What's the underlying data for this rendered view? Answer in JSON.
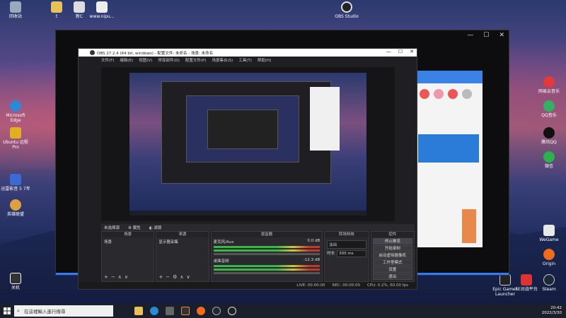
{
  "desktop": {
    "icons_left_top": [
      {
        "label": "回收站",
        "icon": "recycle-bin-icon",
        "color": "#9ab"
      },
      {
        "label": "t",
        "icon": "folder-icon",
        "color": "#e8c15a"
      },
      {
        "label": "新C",
        "icon": "file-icon",
        "color": "#ddd"
      },
      {
        "label": "www.nipu...",
        "icon": "file-icon",
        "color": "#eee"
      }
    ],
    "icons_left": [
      {
        "label": "Microsoft Edge",
        "icon": "edge-icon",
        "color": "#2a8ad4"
      },
      {
        "label": "Ubuntu 远程 Pro",
        "icon": "wifi-icon",
        "color": "#e0b020"
      },
      {
        "label": "迅雷影音 5 7年",
        "icon": "app-icon",
        "color": "#3a6ad4"
      },
      {
        "label": "英雄联盟",
        "icon": "game-icon",
        "color": "#e0a040"
      }
    ],
    "icons_right": [
      {
        "label": "网易云音乐",
        "icon": "music-icon",
        "color": "#e23a3a"
      },
      {
        "label": "QQ音乐",
        "icon": "qqmusic-icon",
        "color": "#30b060"
      },
      {
        "label": "腾讯QQ",
        "icon": "qq-icon",
        "color": "#111"
      },
      {
        "label": "微信",
        "icon": "wechat-icon",
        "color": "#2bb24c"
      },
      {
        "label": "WeGame",
        "icon": "wegame-icon",
        "color": "#e8e8e8"
      },
      {
        "label": "Origin",
        "icon": "origin-icon",
        "color": "#f26a1b"
      },
      {
        "label": "Epic Games Launcher",
        "icon": "epic-icon",
        "color": "#222"
      },
      {
        "label": "5E对战平台",
        "icon": "5e-icon",
        "color": "#d33"
      },
      {
        "label": "Steam",
        "icon": "steam-icon",
        "color": "#1b2838"
      }
    ],
    "top_center_icon": {
      "label": "OBS Studio",
      "icon": "obs-icon"
    },
    "bottom_left_icon": {
      "label": "关机",
      "icon": "power-icon"
    }
  },
  "obs": {
    "title": "OBS 27.2.4 (64 bit, windows) - 配置文件: 未命名 - 场景: 未命名",
    "menu": [
      "文件(F)",
      "编辑(E)",
      "视图(V)",
      "停靠部件(D)",
      "配置文件(P)",
      "场景集合(S)",
      "工具(T)",
      "帮助(H)"
    ],
    "status_row": {
      "source": "未选择源",
      "props": "属性",
      "filters": "滤镜"
    },
    "docks": {
      "scenes": {
        "title": "场景",
        "items": [
          "场景"
        ]
      },
      "sources": {
        "title": "来源",
        "items": [
          "显示器采集"
        ]
      },
      "mixer": {
        "title": "混音器",
        "tracks": [
          {
            "name": "麦克风/Aux",
            "db": "0.0 dB"
          },
          {
            "name": "桌面音频",
            "db": "-12.3 dB"
          }
        ]
      },
      "transitions": {
        "title": "转场特效",
        "type": "淡出",
        "duration_label": "时长",
        "duration": "300 ms"
      },
      "controls": {
        "title": "控件",
        "buttons": [
          "停止推流",
          "开始录制",
          "启动虚拟摄像机",
          "工作室模式",
          "设置",
          "退出"
        ]
      }
    },
    "footer": [
      "LIVE: 00:00:00",
      "REC: 00:00:00",
      "CPU: 0.2%, 60.00 fps"
    ]
  },
  "taskbar": {
    "search_placeholder": "在這裡輸入進行搜尋",
    "time": "20:42",
    "date": "2022/3/30"
  }
}
